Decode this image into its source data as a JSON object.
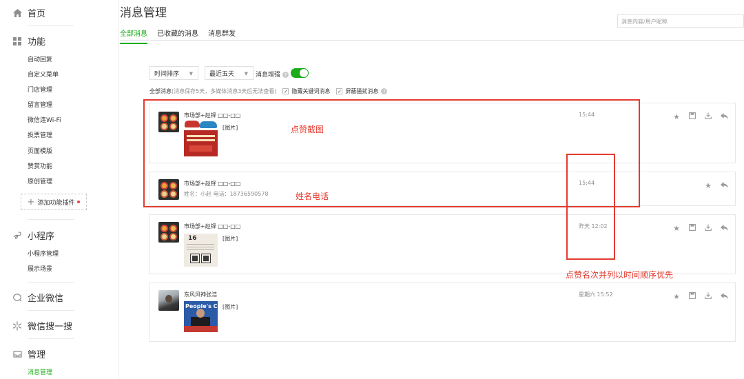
{
  "sidebar": {
    "home": "首页",
    "functions": {
      "title": "功能",
      "items": [
        "自动回复",
        "自定义菜单",
        "门店管理",
        "留言管理",
        "微信连Wi-Fi",
        "投票管理",
        "页面模版",
        "赞赏功能",
        "原创管理"
      ],
      "add_plugin": "添加功能插件"
    },
    "mini_program": {
      "title": "小程序",
      "items": [
        "小程序管理",
        "展示场景"
      ]
    },
    "enterprise_wechat": "企业微信",
    "wechat_search": "微信搜一搜",
    "manage": {
      "title": "管理",
      "items": [
        "消息管理"
      ]
    }
  },
  "header": {
    "title": "消息管理",
    "tabs": [
      "全部消息",
      "已收藏的消息",
      "消息群发"
    ],
    "search_placeholder": "消息内容/用户昵称"
  },
  "toolbar": {
    "sort": "时间排序",
    "range": "最近五天",
    "enhance": "消息增强",
    "enhance_on": true,
    "filter_prefix": "全部消息",
    "filter_note": "(消息保存5天，多媒体消息3天后无法查看)",
    "hide_keyword": "隐藏关键词消息",
    "block_harass": "屏蔽骚扰消息"
  },
  "messages": [
    {
      "sender": "市场部+赵铎 □□-□□",
      "time": "15:44",
      "content": "[图片]"
    },
    {
      "sender": "市场部+赵铎 □□-□□",
      "time": "15:44",
      "content": "姓名：小赵 电话：18736590578"
    },
    {
      "sender": "市场部+赵铎 □□-□□",
      "time": "昨天 12:02",
      "content": "[图片]",
      "doc_number": "16"
    },
    {
      "sender": "东风风神张浩",
      "time": "星期六 15:52",
      "content": "[图片]",
      "news_sign": "People's Cong"
    }
  ],
  "icons": {
    "star": "star-icon",
    "save": "save-icon",
    "download": "download-icon",
    "reply": "reply-icon"
  },
  "annotations": {
    "screenshot": "点赞截图",
    "name_phone": "姓名电话",
    "order_note": "点赞名次并列以时间顺序优先"
  },
  "colors": {
    "accent": "#1aad19",
    "annotation": "#e43a2f"
  }
}
